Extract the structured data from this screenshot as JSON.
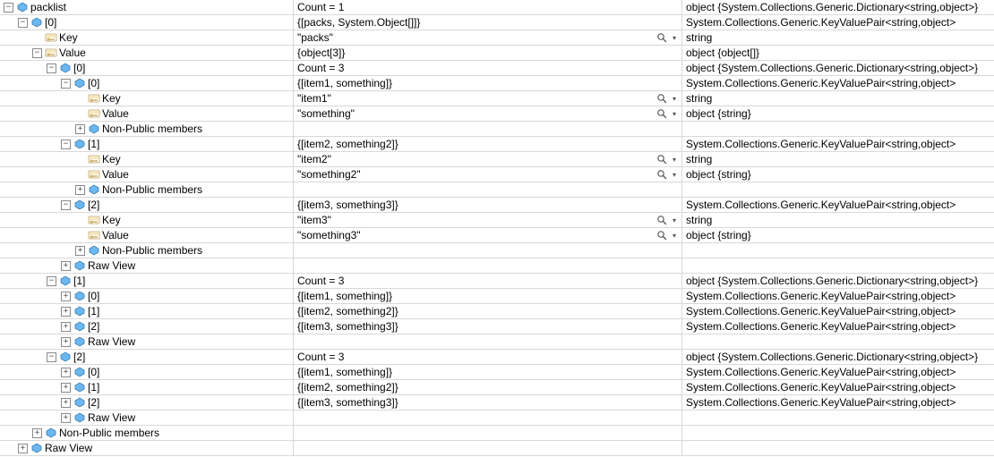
{
  "rows": [
    {
      "indent": 0,
      "expander": "minus",
      "icon": "field",
      "name": "packlist",
      "value": "Count = 1",
      "type": "object {System.Collections.Generic.Dictionary<string,object>}",
      "magnify": false,
      "interactableName": true
    },
    {
      "indent": 1,
      "expander": "minus",
      "icon": "field",
      "name": "[0]",
      "value": "{[packs, System.Object[]]}",
      "type": "System.Collections.Generic.KeyValuePair<string,object>",
      "magnify": false,
      "interactableName": true
    },
    {
      "indent": 2,
      "expander": "none",
      "icon": "key",
      "name": "Key",
      "value": "\"packs\"",
      "type": "string",
      "magnify": true,
      "interactableName": true
    },
    {
      "indent": 2,
      "expander": "minus",
      "icon": "key",
      "name": "Value",
      "value": "{object[3]}",
      "type": "object {object[]}",
      "magnify": false,
      "interactableName": true
    },
    {
      "indent": 3,
      "expander": "minus",
      "icon": "field",
      "name": "[0]",
      "value": "Count = 3",
      "type": "object {System.Collections.Generic.Dictionary<string,object>}",
      "magnify": false,
      "interactableName": true
    },
    {
      "indent": 4,
      "expander": "minus",
      "icon": "field",
      "name": "[0]",
      "value": "{[item1, something]}",
      "type": "System.Collections.Generic.KeyValuePair<string,object>",
      "magnify": false,
      "interactableName": true
    },
    {
      "indent": 5,
      "expander": "none",
      "icon": "key",
      "name": "Key",
      "value": "\"item1\"",
      "type": "string",
      "magnify": true,
      "interactableName": true
    },
    {
      "indent": 5,
      "expander": "none",
      "icon": "key",
      "name": "Value",
      "value": "\"something\"",
      "type": "object {string}",
      "magnify": true,
      "interactableName": true
    },
    {
      "indent": 5,
      "expander": "plus",
      "icon": "field",
      "name": "Non-Public members",
      "value": "",
      "type": "",
      "magnify": false,
      "interactableName": true
    },
    {
      "indent": 4,
      "expander": "minus",
      "icon": "field",
      "name": "[1]",
      "value": "{[item2, something2]}",
      "type": "System.Collections.Generic.KeyValuePair<string,object>",
      "magnify": false,
      "interactableName": true
    },
    {
      "indent": 5,
      "expander": "none",
      "icon": "key",
      "name": "Key",
      "value": "\"item2\"",
      "type": "string",
      "magnify": true,
      "interactableName": true
    },
    {
      "indent": 5,
      "expander": "none",
      "icon": "key",
      "name": "Value",
      "value": "\"something2\"",
      "type": "object {string}",
      "magnify": true,
      "interactableName": true
    },
    {
      "indent": 5,
      "expander": "plus",
      "icon": "field",
      "name": "Non-Public members",
      "value": "",
      "type": "",
      "magnify": false,
      "interactableName": true
    },
    {
      "indent": 4,
      "expander": "minus",
      "icon": "field",
      "name": "[2]",
      "value": "{[item3, something3]}",
      "type": "System.Collections.Generic.KeyValuePair<string,object>",
      "magnify": false,
      "interactableName": true
    },
    {
      "indent": 5,
      "expander": "none",
      "icon": "key",
      "name": "Key",
      "value": "\"item3\"",
      "type": "string",
      "magnify": true,
      "interactableName": true
    },
    {
      "indent": 5,
      "expander": "none",
      "icon": "key",
      "name": "Value",
      "value": "\"something3\"",
      "type": "object {string}",
      "magnify": true,
      "interactableName": true
    },
    {
      "indent": 5,
      "expander": "plus",
      "icon": "field",
      "name": "Non-Public members",
      "value": "",
      "type": "",
      "magnify": false,
      "interactableName": true
    },
    {
      "indent": 4,
      "expander": "plus",
      "icon": "field",
      "name": "Raw View",
      "value": "",
      "type": "",
      "magnify": false,
      "interactableName": true
    },
    {
      "indent": 3,
      "expander": "minus",
      "icon": "field",
      "name": "[1]",
      "value": "Count = 3",
      "type": "object {System.Collections.Generic.Dictionary<string,object>}",
      "magnify": false,
      "interactableName": true
    },
    {
      "indent": 4,
      "expander": "plus",
      "icon": "field",
      "name": "[0]",
      "value": "{[item1, something]}",
      "type": "System.Collections.Generic.KeyValuePair<string,object>",
      "magnify": false,
      "interactableName": true
    },
    {
      "indent": 4,
      "expander": "plus",
      "icon": "field",
      "name": "[1]",
      "value": "{[item2, something2]}",
      "type": "System.Collections.Generic.KeyValuePair<string,object>",
      "magnify": false,
      "interactableName": true
    },
    {
      "indent": 4,
      "expander": "plus",
      "icon": "field",
      "name": "[2]",
      "value": "{[item3, something3]}",
      "type": "System.Collections.Generic.KeyValuePair<string,object>",
      "magnify": false,
      "interactableName": true
    },
    {
      "indent": 4,
      "expander": "plus",
      "icon": "field",
      "name": "Raw View",
      "value": "",
      "type": "",
      "magnify": false,
      "interactableName": true
    },
    {
      "indent": 3,
      "expander": "minus",
      "icon": "field",
      "name": "[2]",
      "value": "Count = 3",
      "type": "object {System.Collections.Generic.Dictionary<string,object>}",
      "magnify": false,
      "interactableName": true
    },
    {
      "indent": 4,
      "expander": "plus",
      "icon": "field",
      "name": "[0]",
      "value": "{[item1, something]}",
      "type": "System.Collections.Generic.KeyValuePair<string,object>",
      "magnify": false,
      "interactableName": true
    },
    {
      "indent": 4,
      "expander": "plus",
      "icon": "field",
      "name": "[1]",
      "value": "{[item2, something2]}",
      "type": "System.Collections.Generic.KeyValuePair<string,object>",
      "magnify": false,
      "interactableName": true
    },
    {
      "indent": 4,
      "expander": "plus",
      "icon": "field",
      "name": "[2]",
      "value": "{[item3, something3]}",
      "type": "System.Collections.Generic.KeyValuePair<string,object>",
      "magnify": false,
      "interactableName": true
    },
    {
      "indent": 4,
      "expander": "plus",
      "icon": "field",
      "name": "Raw View",
      "value": "",
      "type": "",
      "magnify": false,
      "interactableName": true
    },
    {
      "indent": 2,
      "expander": "plus",
      "icon": "field",
      "name": "Non-Public members",
      "value": "",
      "type": "",
      "magnify": false,
      "interactableName": true
    },
    {
      "indent": 1,
      "expander": "plus",
      "icon": "field",
      "name": "Raw View",
      "value": "",
      "type": "",
      "magnify": false,
      "interactableName": true
    }
  ],
  "icons": {
    "plus_glyph": "+",
    "minus_glyph": "−",
    "chevron_glyph": "▾"
  }
}
